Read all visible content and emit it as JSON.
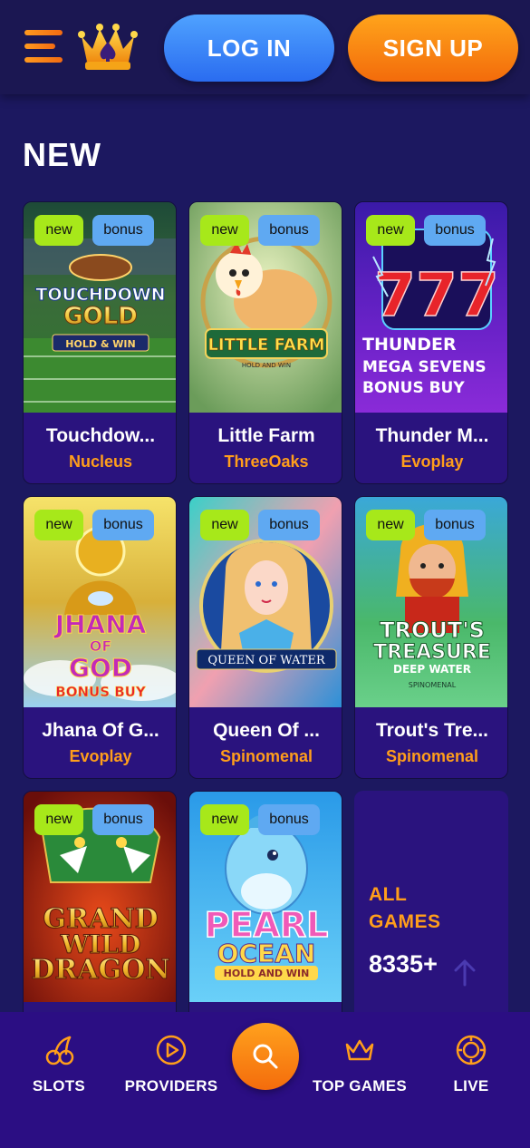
{
  "header": {
    "login_label": "LOG IN",
    "signup_label": "SIGN UP",
    "menu_icon": "hamburger-menu-icon",
    "logo_icon": "crown-logo-icon"
  },
  "section": {
    "title": "NEW"
  },
  "games": [
    {
      "name": "Touchdow...",
      "provider": "Nucleus",
      "badge_new": "new",
      "badge_bonus": "bonus",
      "art_text": [
        "TOUCHDOWN",
        "GOLD",
        "HOLD & WIN"
      ]
    },
    {
      "name": "Little Farm",
      "provider": "ThreeOaks",
      "badge_new": "new",
      "badge_bonus": "bonus",
      "art_text": [
        "LITTLE FARM",
        "HOLD AND WIN"
      ]
    },
    {
      "name": "Thunder M...",
      "provider": "Evoplay",
      "badge_new": "new",
      "badge_bonus": "bonus",
      "art_text": [
        "777",
        "THUNDER",
        "MEGA SEVENS",
        "BONUS BUY"
      ]
    },
    {
      "name": "Jhana Of G...",
      "provider": "Evoplay",
      "badge_new": "new",
      "badge_bonus": "bonus",
      "art_text": [
        "JHANA",
        "OF",
        "GOD",
        "BONUS BUY"
      ]
    },
    {
      "name": "Queen Of ...",
      "provider": "Spinomenal",
      "badge_new": "new",
      "badge_bonus": "bonus",
      "art_text": [
        "QUEEN OF WATER"
      ]
    },
    {
      "name": "Trout's Tre...",
      "provider": "Spinomenal",
      "badge_new": "new",
      "badge_bonus": "bonus",
      "art_text": [
        "TROUT'S",
        "TREASURE",
        "DEEP WATER",
        "SPINOMENAL"
      ]
    },
    {
      "name": "",
      "provider": "",
      "badge_new": "new",
      "badge_bonus": "bonus",
      "art_text": [
        "GRAND",
        "WILD",
        "DRAGON"
      ]
    },
    {
      "name": "",
      "provider": "",
      "badge_new": "new",
      "badge_bonus": "bonus",
      "art_text": [
        "PEARL",
        "OCEAN",
        "HOLD AND WIN"
      ]
    }
  ],
  "all_games": {
    "label": "ALL GAMES",
    "count": "8335+"
  },
  "bottom_nav": {
    "slots": "SLOTS",
    "providers": "PROVIDERS",
    "top_games": "TOP GAMES",
    "live": "LIVE"
  },
  "colors": {
    "background": "#1c1860",
    "card": "#2a137e",
    "accent_orange": "#ff9e1b",
    "login_blue": "#3d86f7",
    "badge_new": "#a7e81a",
    "badge_bonus": "#5fa9f2"
  }
}
